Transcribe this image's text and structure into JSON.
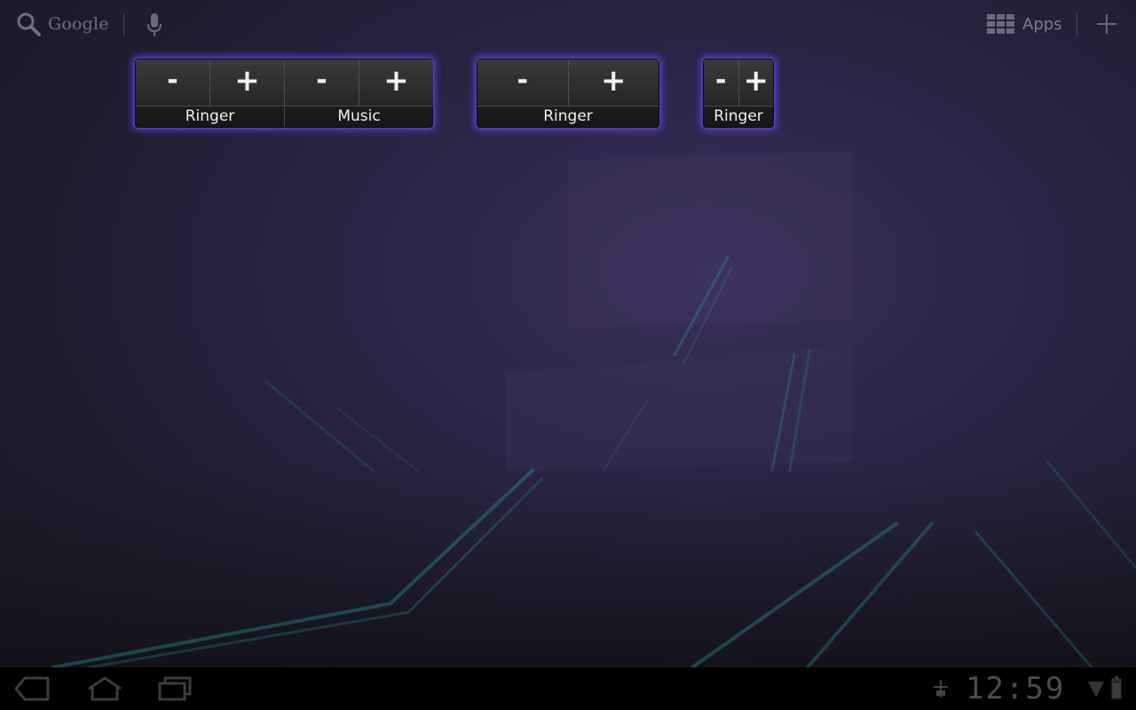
{
  "topbar": {
    "search_label": "Google",
    "apps_label": "Apps",
    "icons": [
      "search-icon",
      "mic-icon",
      "apps-grid-icon",
      "add-icon"
    ]
  },
  "widgets": [
    {
      "groups": [
        {
          "label": "Ringer",
          "minus": "-",
          "plus": "+"
        },
        {
          "label": "Music",
          "minus": "-",
          "plus": "+"
        }
      ]
    },
    {
      "groups": [
        {
          "label": "Ringer",
          "minus": "-",
          "plus": "+"
        }
      ]
    },
    {
      "groups": [
        {
          "label": "Ringer",
          "minus": "-",
          "plus": "+"
        }
      ]
    }
  ],
  "sysbar": {
    "clock": "12:59",
    "icons": [
      "back-icon",
      "home-icon",
      "recent-apps-icon",
      "usb-icon",
      "signal-icon",
      "battery-icon"
    ]
  },
  "colors": {
    "widget_glow": "#5c3cdc",
    "wallpaper_line": "#1fa9a6"
  }
}
